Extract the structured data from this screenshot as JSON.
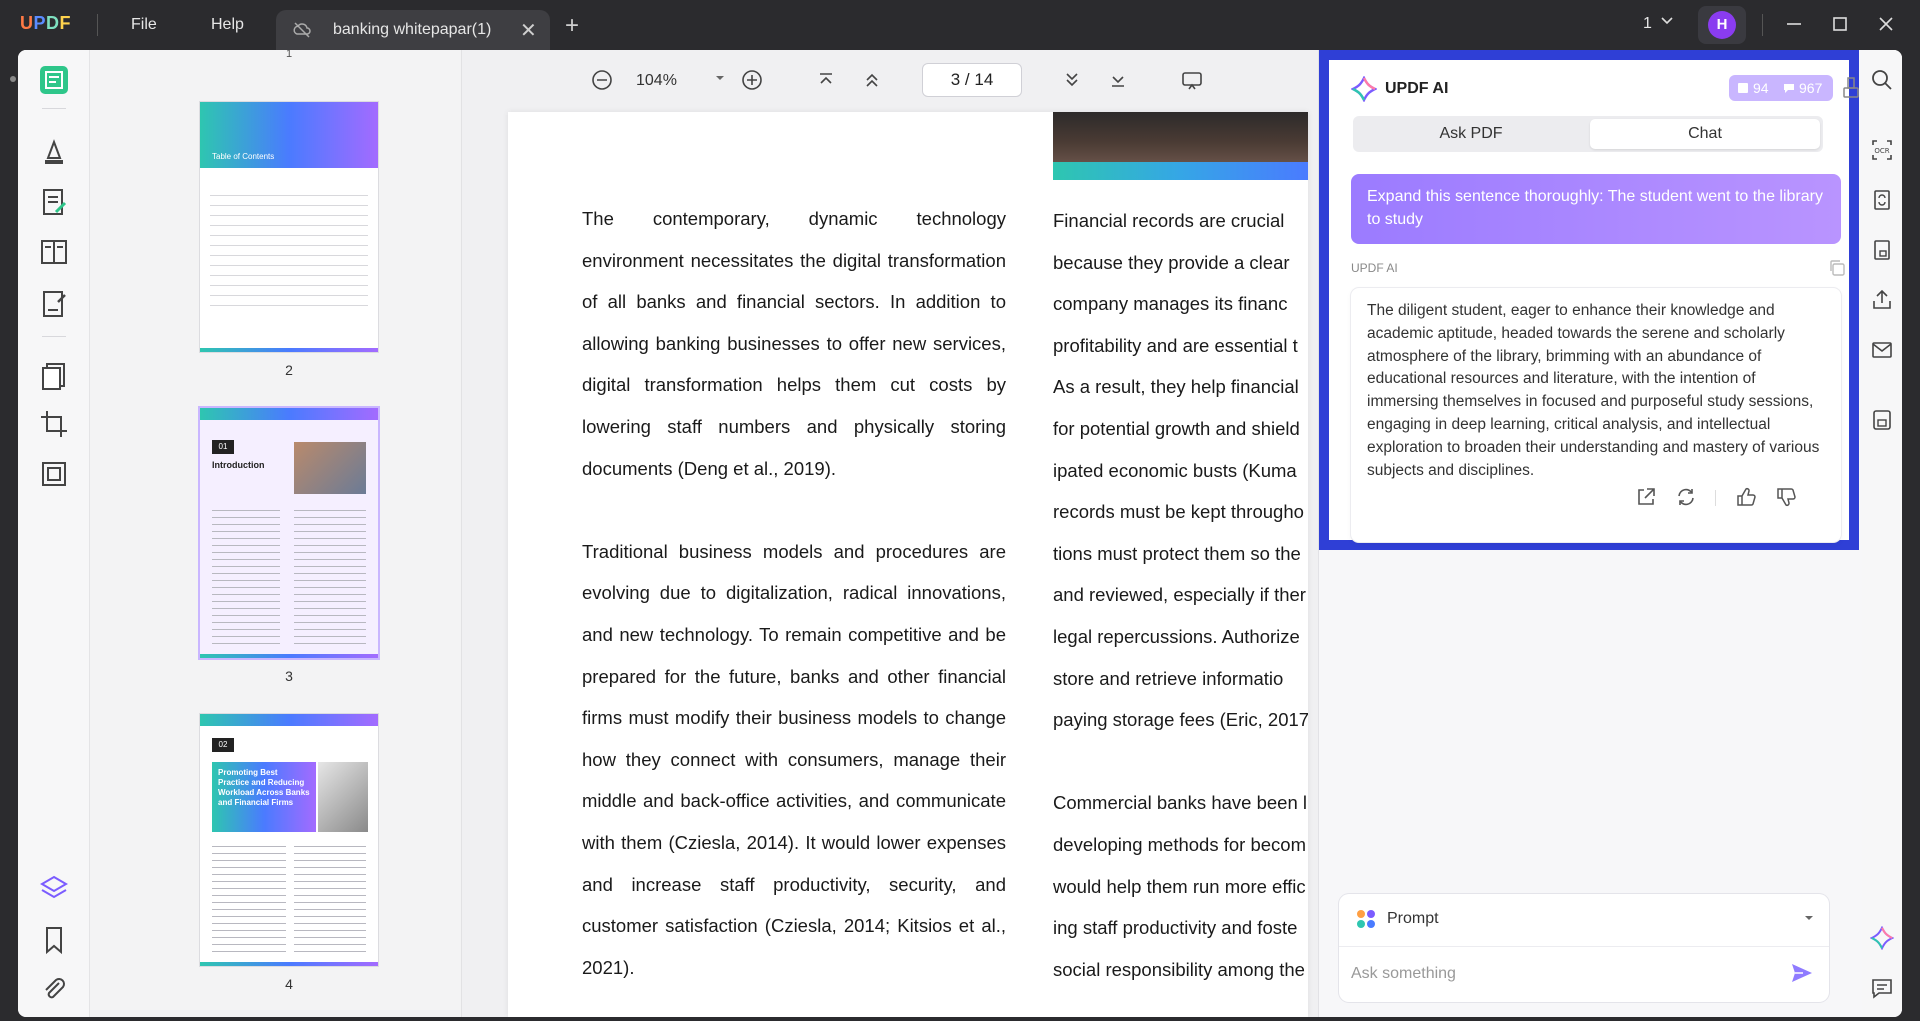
{
  "titlebar": {
    "logo": {
      "u": "U",
      "p": "P",
      "d": "D",
      "f": "F"
    },
    "menu_file": "File",
    "menu_help": "Help",
    "tab_title": "banking whitepapar(1)",
    "tab_close": "✕",
    "new_tab": "+",
    "window_count": "1",
    "avatar_initial": "H"
  },
  "thumbnails": {
    "page2_title": "Table of Contents",
    "page2_label": "2",
    "page3_num": "01",
    "page3_title": "Introduction",
    "page3_label": "3",
    "page4_num": "02",
    "page4_title": "Promoting Best Practice and Reducing Workload Across Banks and Financial Firms",
    "page4_label": "4",
    "top_partial_label": "1"
  },
  "toolbar": {
    "zoom": "104%",
    "current_page": "3",
    "page_sep": "/",
    "total_pages": "14"
  },
  "document": {
    "left_col": [
      "The contemporary, dynamic technology environment necessitates the digital transformation of all banks and financial sectors. In addition to allowing banking businesses to offer new services, digital transformation helps them cut costs by lowering staff numbers and physically storing documents (Deng et al., 2019).",
      "Traditional business models and procedures are evolving due to digitalization, radical innovations, and new technology. To remain competitive and be prepared for the future, banks and other financial firms must modify their business models to change how they connect with consumers, manage their middle and back-office activities, and communicate with them (Cziesla, 2014). It would lower expenses and increase staff productivity, security, and customer satisfaction (Cziesla, 2014; Kitsios et al., 2021)."
    ],
    "right_col_lines_p1": [
      "Financial records are crucial",
      "because they provide a clear",
      "company manages its financ",
      "profitability and are essential t",
      "As a result, they help financial",
      "for potential growth and shield",
      "ipated economic busts (Kuma",
      "records must be kept througho",
      "tions must protect them so the",
      "and reviewed, especially if ther",
      "legal repercussions. Authorize",
      "store and retrieve informatio",
      "paying storage fees (Eric, 2017"
    ],
    "right_col_lines_p2": [
      "Commercial banks have been l",
      "developing methods for becom",
      "would help them run more effic",
      "ing staff productivity and foste",
      "social responsibility among the"
    ]
  },
  "ai_panel": {
    "title": "UPDF AI",
    "credits_a": "94",
    "credits_b": "967",
    "tab_ask_pdf": "Ask PDF",
    "tab_chat": "Chat",
    "user_message": "Expand this sentence thoroughly: The student went to the library to study",
    "responder_label": "UPDF AI",
    "answer": "The diligent student, eager to enhance their knowledge and academic aptitude, headed towards the serene and scholarly atmosphere of the library, brimming with an abundance of educational resources and literature, with the intention of immersing themselves in focused and purposeful study sessions, engaging in deep learning, critical analysis, and intellectual exploration to broaden their understanding and mastery of various subjects and disciplines.",
    "prompt_label": "Prompt",
    "ask_placeholder": "Ask something"
  },
  "colors": {
    "accent_purple": "#9b7bff",
    "frame_blue": "#2f3fd6",
    "avatar_purple": "#8a3cf0",
    "rail_green": "#2ec68a"
  }
}
